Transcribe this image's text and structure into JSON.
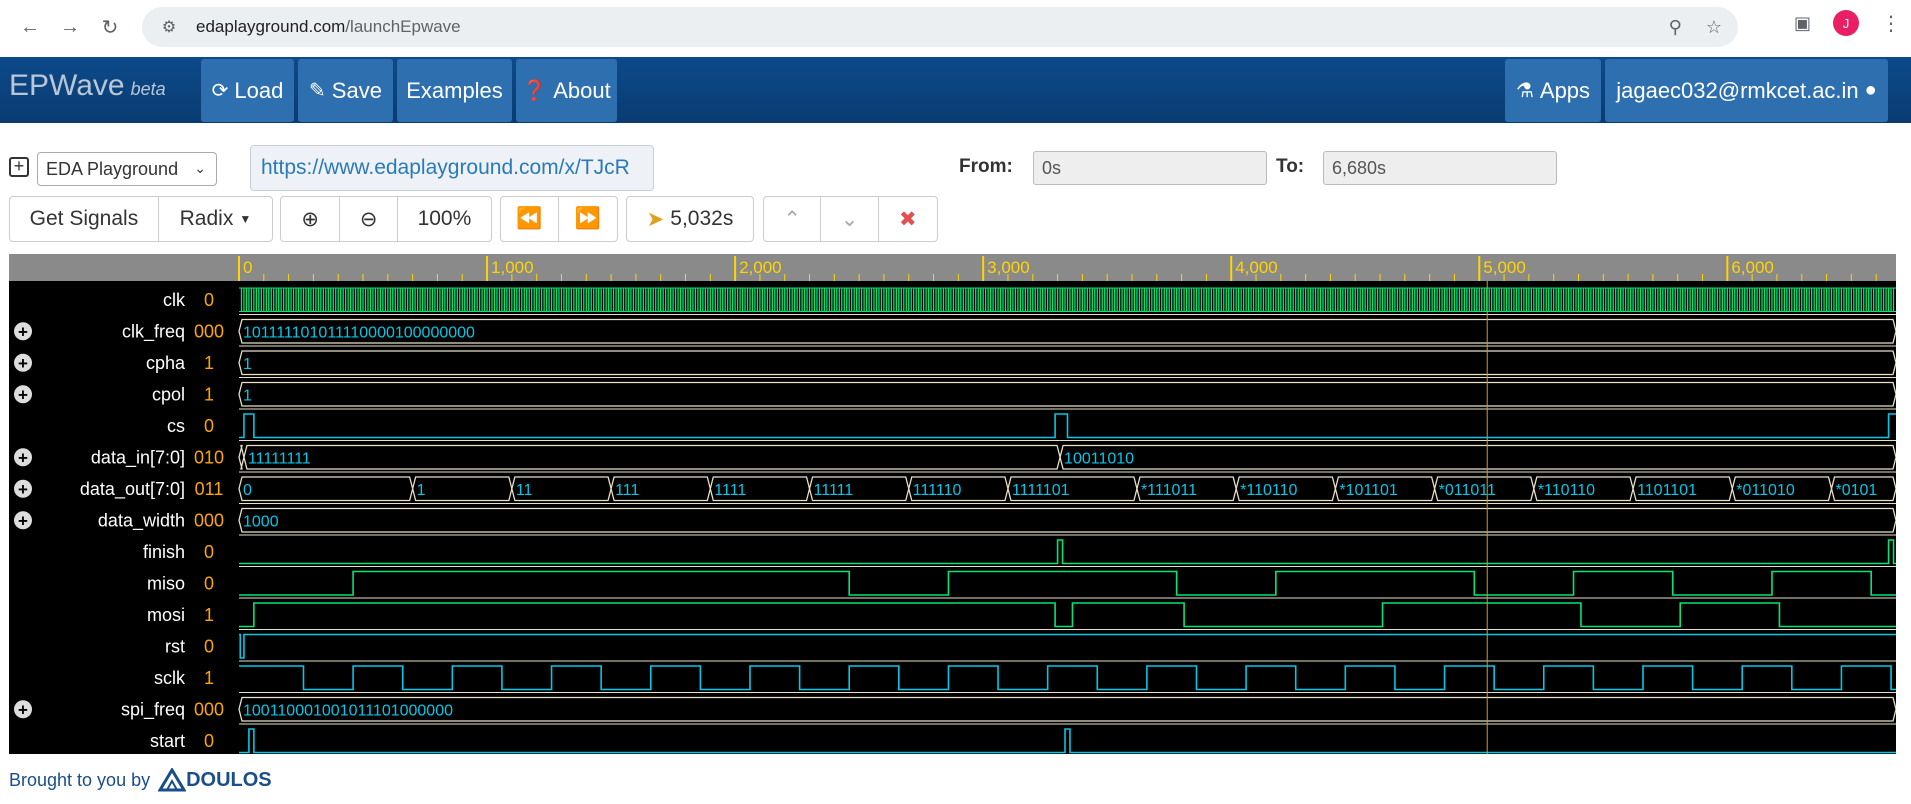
{
  "browser": {
    "url_host": "edaplayground.com",
    "url_path": "/launchEpwave",
    "avatar_letter": "J"
  },
  "navbar": {
    "brand": "EPWave",
    "beta": "beta",
    "load": "Load",
    "save": "Save",
    "examples": "Examples",
    "about": "About",
    "apps": "Apps",
    "user": "jagaec032@rmkcet.ac.in"
  },
  "toolbar": {
    "source_select": "EDA Playground",
    "share_url": "https://www.edaplayground.com/x/TJcR",
    "from_label": "From:",
    "from_value": "0s",
    "to_label": "To:",
    "to_value": "6,680s",
    "get_signals": "Get Signals",
    "radix": "Radix",
    "zoom": "100%",
    "cursor_time": "5,032s"
  },
  "ruler": {
    "ticks": [
      "0",
      "1,000",
      "2,000",
      "3,000",
      "4,000",
      "5,000",
      "6,000"
    ]
  },
  "signals": [
    {
      "name": "clk",
      "value": "0",
      "expandable": false
    },
    {
      "name": "clk_freq",
      "value": "000",
      "expandable": true,
      "bus_text": "101111101011110000100000000"
    },
    {
      "name": "cpha",
      "value": "1",
      "expandable": true,
      "bus_text": "1"
    },
    {
      "name": "cpol",
      "value": "1",
      "expandable": true,
      "bus_text": "1"
    },
    {
      "name": "cs",
      "value": "0",
      "expandable": false
    },
    {
      "name": "data_in[7:0]",
      "value": "010",
      "expandable": true
    },
    {
      "name": "data_out[7:0]",
      "value": "011",
      "expandable": true
    },
    {
      "name": "data_width",
      "value": "000",
      "expandable": true,
      "bus_text": "1000"
    },
    {
      "name": "finish",
      "value": "0",
      "expandable": false
    },
    {
      "name": "miso",
      "value": "0",
      "expandable": false
    },
    {
      "name": "mosi",
      "value": "1",
      "expandable": false
    },
    {
      "name": "rst",
      "value": "0",
      "expandable": false
    },
    {
      "name": "sclk",
      "value": "1",
      "expandable": false
    },
    {
      "name": "spi_freq",
      "value": "000",
      "expandable": true,
      "bus_text": "100110001001011101000000"
    },
    {
      "name": "start",
      "value": "0",
      "expandable": false
    }
  ],
  "data_in_segments": [
    "11111111",
    "10011010"
  ],
  "data_out_segments": [
    "0",
    "1",
    "11",
    "111",
    "1111",
    "11111",
    "111110",
    "1111101",
    "*111011",
    "*110110",
    "*101101",
    "*011011",
    "*110110",
    "1101101",
    "*011010",
    "*0101"
  ],
  "footer": {
    "text": "Brought to you by",
    "brand": "DOULOS"
  }
}
